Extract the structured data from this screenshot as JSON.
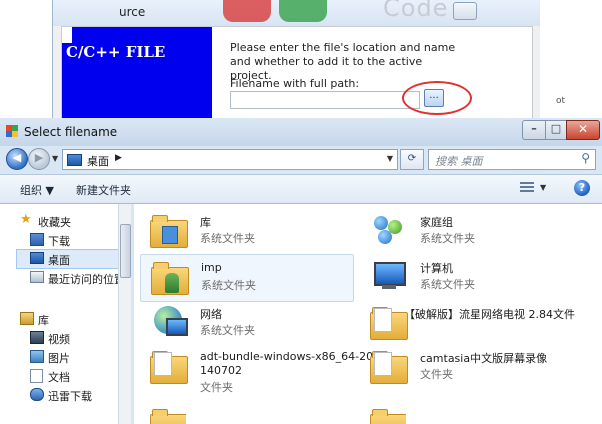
{
  "background_dialog": {
    "title_fragment": "urce",
    "watermark": "Code",
    "banner_text": "C/C++ FILE",
    "description": "Please enter the file's location and name and whether to add it to the active project.",
    "filename_label": "Filename with full path:",
    "filename_value": "",
    "browse_label": "...",
    "right_edge_text": "ot"
  },
  "window": {
    "title": "Select filename",
    "minimize_glyph": "–",
    "maximize_glyph": "□",
    "close_glyph": "✕"
  },
  "nav": {
    "back_glyph": "◀",
    "forward_glyph": "▶",
    "dropdown_glyph": "▼",
    "address_crumb": "桌面",
    "address_sep": "▶",
    "address_dropdown": "▼",
    "refresh_glyph": "⟳",
    "search_placeholder": "搜索 桌面",
    "search_icon": "⚲"
  },
  "toolbar": {
    "organize": "组织 ▼",
    "new_folder": "新建文件夹",
    "view_dropdown": "▼",
    "help": "?"
  },
  "pane": {
    "items": [
      {
        "label": "收藏夹",
        "icon": "star-icon"
      },
      {
        "label": "下载",
        "icon": "download-folder-icon"
      },
      {
        "label": "桌面",
        "icon": "desktop-icon"
      },
      {
        "label": "最近访问的位置",
        "icon": "recent-places-icon"
      },
      {
        "label": "库",
        "icon": "library-icon"
      },
      {
        "label": "视频",
        "icon": "video-library-icon"
      },
      {
        "label": "图片",
        "icon": "pictures-library-icon"
      },
      {
        "label": "文档",
        "icon": "documents-library-icon"
      },
      {
        "label": "迅雷下载",
        "icon": "thunder-download-icon"
      }
    ]
  },
  "content": {
    "items": [
      {
        "name": "库",
        "type": "系统文件夹",
        "icon": "library-folder-icon"
      },
      {
        "name": "家庭组",
        "type": "系统文件夹",
        "icon": "homegroup-icon"
      },
      {
        "name": "imp",
        "type": "系统文件夹",
        "icon": "user-folder-icon"
      },
      {
        "name": "计算机",
        "type": "系统文件夹",
        "icon": "computer-icon"
      },
      {
        "name": "网络",
        "type": "系统文件夹",
        "icon": "network-icon"
      },
      {
        "name": "【破解版】流星网络电视 2.84文件",
        "type": "",
        "icon": "folder-icon"
      },
      {
        "name": "adt-bundle-windows-x86_64-20",
        "name2": "140702",
        "type": "文件夹",
        "icon": "folder-icon"
      },
      {
        "name": "camtasia中文版屏幕录像",
        "type": "文件夹",
        "icon": "folder-icon"
      }
    ]
  },
  "colors": {
    "banner": "#0000ee",
    "highlight_circle": "#e03030",
    "selection": "#dceaf9"
  }
}
